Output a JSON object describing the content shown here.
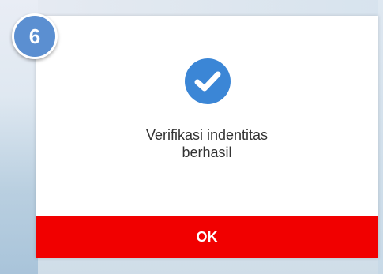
{
  "step_badge": {
    "number": "6",
    "color": "#5b8fd1"
  },
  "dialog": {
    "icon": "check-circle-icon",
    "icon_color": "#3b86d6",
    "message_line1": "Verifikasi indentitas",
    "message_line2": "berhasil",
    "ok_label": "OK",
    "ok_color": "#f10000"
  }
}
